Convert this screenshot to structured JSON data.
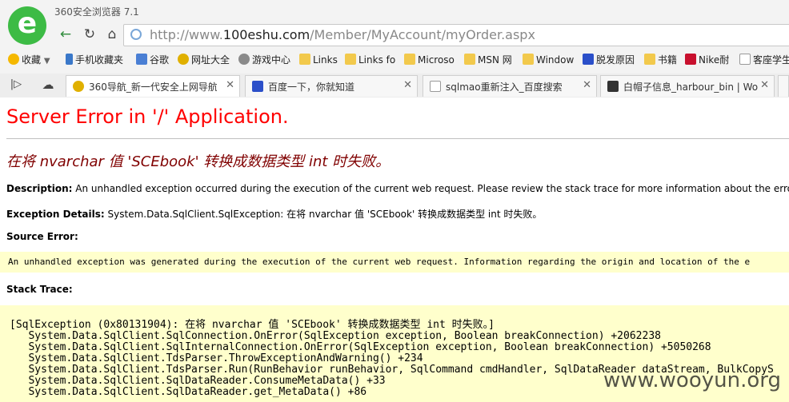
{
  "browser": {
    "app_title": "360安全浏览器 7.1",
    "url_prefix": "http://www.",
    "url_domain": "100eshu.com",
    "url_path": "/Member/MyAccount/myOrder.aspx",
    "bookmarks": [
      "收藏",
      "手机收藏夹",
      "谷歌",
      "网址大全",
      "游戏中心",
      "Links",
      "Links fo",
      "Microso",
      "MSN 网",
      "Window",
      "脱发原因",
      "书籍",
      "Nike耐",
      "客座学生"
    ],
    "tabs": [
      "360导航_新一代安全上网导航",
      "百度一下，你就知道",
      "sqlmao重新注入_百度搜索",
      "白帽子信息_harbour_bin | Wo"
    ]
  },
  "error_page": {
    "title": "Server Error in '/' Application.",
    "message": "在将 nvarchar 值 'SCEbook' 转换成数据类型 int 时失败。",
    "description_label": "Description:",
    "description_text": "An unhandled exception occurred during the execution of the current web request. Please review the stack trace for more information about the error and where it orig",
    "exception_label": "Exception Details:",
    "exception_text": "System.Data.SqlClient.SqlException: 在将 nvarchar 值 'SCEbook' 转换成数据类型 int 时失败。",
    "source_label": "Source Error:",
    "source_text": "An unhandled exception was generated during the execution of the current web request. Information regarding the origin and location of the e",
    "stack_label": "Stack Trace:",
    "stack_lines": [
      "[SqlException (0x80131904): 在将 nvarchar 值 'SCEbook' 转换成数据类型 int 时失败。]",
      "   System.Data.SqlClient.SqlConnection.OnError(SqlException exception, Boolean breakConnection) +2062238",
      "   System.Data.SqlClient.SqlInternalConnection.OnError(SqlException exception, Boolean breakConnection) +5050268",
      "   System.Data.SqlClient.TdsParser.ThrowExceptionAndWarning() +234",
      "   System.Data.SqlClient.TdsParser.Run(RunBehavior runBehavior, SqlCommand cmdHandler, SqlDataReader dataStream, BulkCopyS",
      "   System.Data.SqlClient.SqlDataReader.ConsumeMetaData() +33",
      "   System.Data.SqlClient.SqlDataReader.get_MetaData() +86"
    ]
  },
  "watermark": "www.wooyun.org"
}
